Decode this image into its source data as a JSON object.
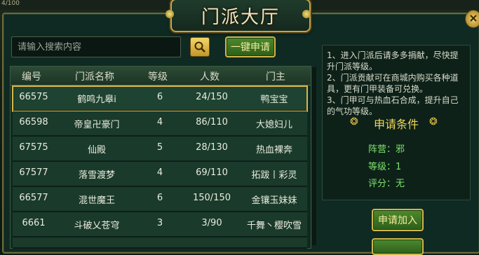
{
  "topbar": {
    "hp_text": "4/100"
  },
  "window": {
    "title": "门派大厅"
  },
  "search": {
    "placeholder": "请输入搜索内容"
  },
  "buttons": {
    "quick_apply": "一键申请",
    "apply_join": "申请加入"
  },
  "table": {
    "headers": [
      "编号",
      "门派名称",
      "等级",
      "人数",
      "门主"
    ],
    "rows": [
      {
        "id": "66575",
        "name": "鹤鸣九皋i",
        "level": "6",
        "members": "24/150",
        "master": "鸭宝宝",
        "selected": true
      },
      {
        "id": "66598",
        "name": "帝皇卍豪门",
        "level": "4",
        "members": "86/110",
        "master": "大媳妇儿"
      },
      {
        "id": "67575",
        "name": "仙殿",
        "level": "5",
        "members": "28/130",
        "master": "热血裸奔"
      },
      {
        "id": "67577",
        "name": "落雪渡梦",
        "level": "4",
        "members": "69/110",
        "master": "拓跋丨彩灵"
      },
      {
        "id": "66577",
        "name": "混世魔王",
        "level": "6",
        "members": "150/150",
        "master": "金镶玉妹妹"
      },
      {
        "id": "6661",
        "name": "斗破乂苍穹",
        "level": "3",
        "members": "3/90",
        "master": "千舞丶樱吹雪"
      }
    ]
  },
  "info": {
    "tips": [
      "1、进入门派后请多多捐献，尽快提升门派等级。",
      "2、门派贡献可在商城内购买各种道具，更有门甲装备可兑换。",
      "3、门甲可与热血石合成，提升自己的气功等级。"
    ],
    "cond_title": "申请条件",
    "conditions": [
      "阵营：邪",
      "等级：1",
      "评分：无"
    ]
  },
  "colors": {
    "gold": "#d6b44a",
    "green_text": "#7ee36a",
    "title_text": "#f1e7bd"
  }
}
